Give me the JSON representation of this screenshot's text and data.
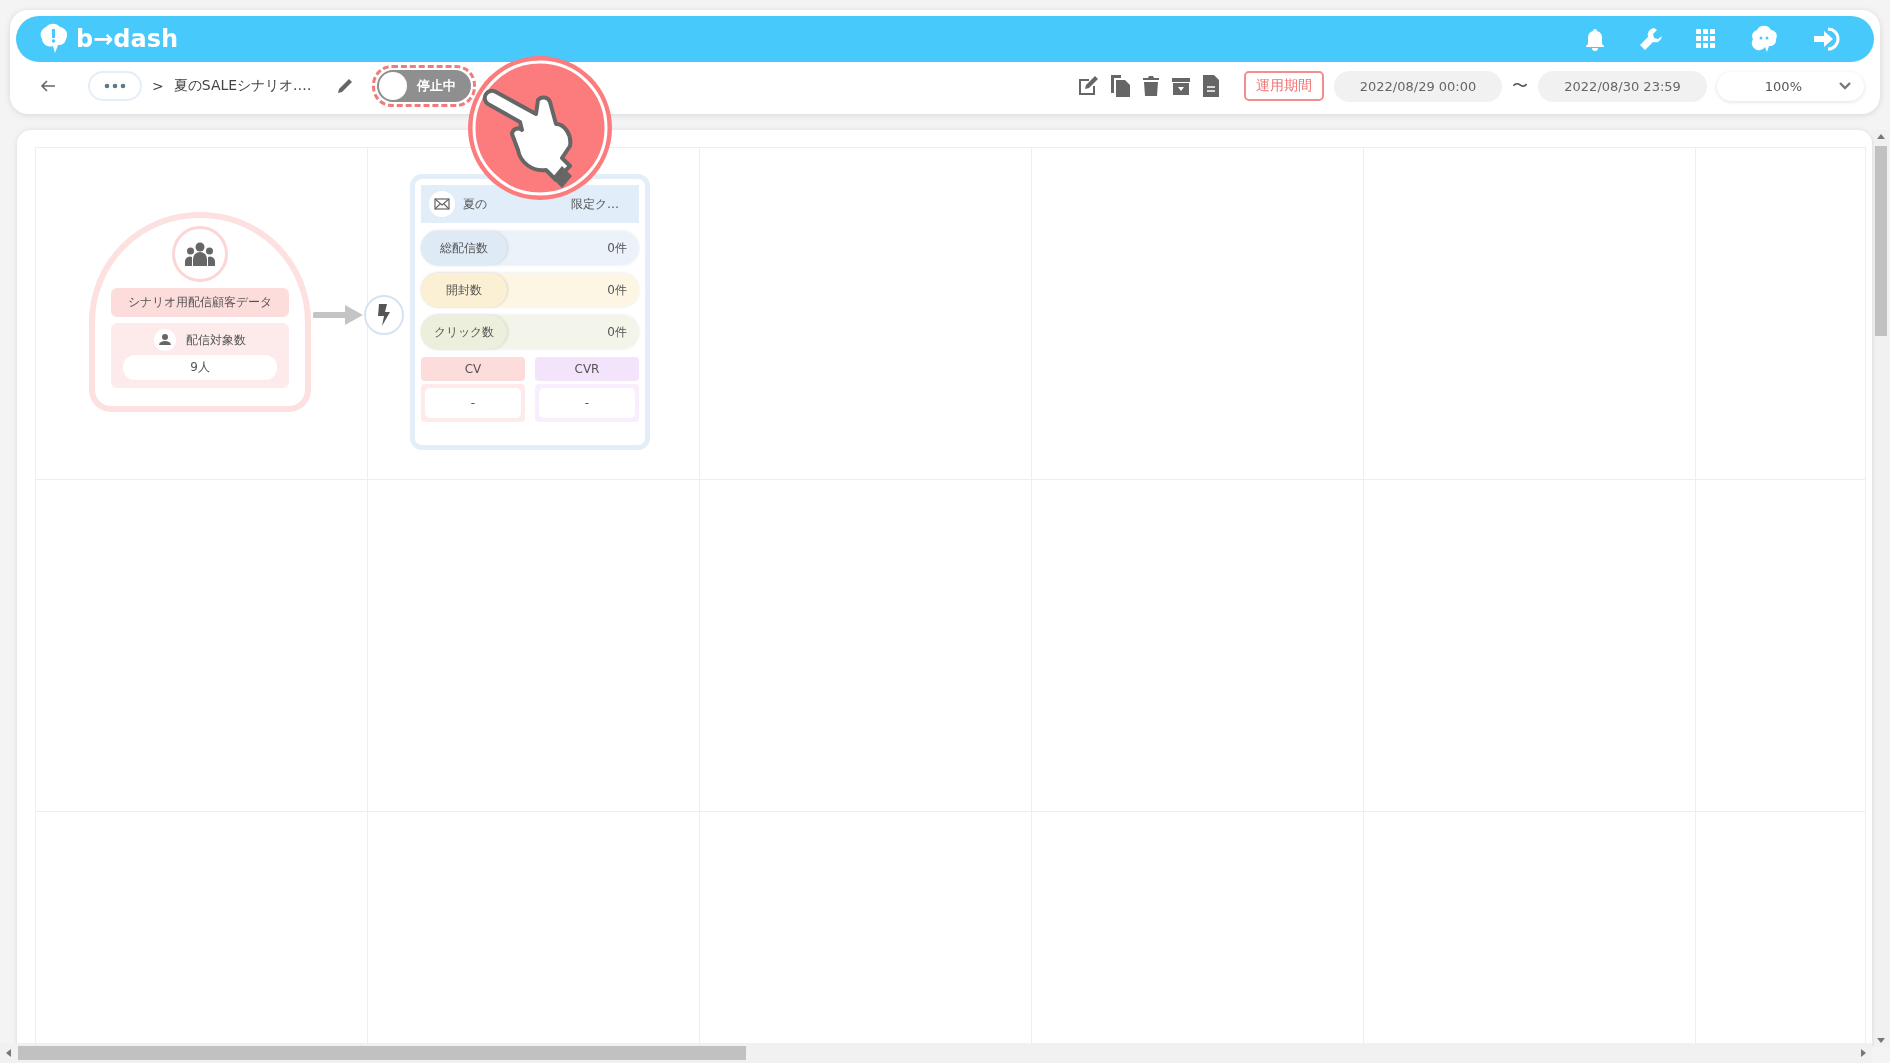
{
  "header": {
    "logo": "b→dash"
  },
  "toolbar": {
    "breadcrumb_separator": ">",
    "breadcrumb": "夏のSALEシナリオ.…",
    "toggle": {
      "label": "停止中",
      "on": false
    },
    "period_button": "運用期間",
    "start": "2022/08/29 00:00",
    "range_sep": "〜",
    "end": "2022/08/30 23:59",
    "zoom": "100%"
  },
  "audience_node": {
    "title": "シナリオ用配信顧客データ",
    "count_label": "配信対象数",
    "count": "9人"
  },
  "mail_node": {
    "title_start": "夏の",
    "title_end": "限定ク…",
    "metrics": [
      {
        "label": "総配信数",
        "value": "0件",
        "color": "#dfeaf7"
      },
      {
        "label": "開封数",
        "value": "0件",
        "color": "#fbf0d3"
      },
      {
        "label": "クリック数",
        "value": "0件",
        "color": "#ebefdc"
      }
    ],
    "results": [
      {
        "label": "CV",
        "value": "-",
        "color": "#fddcdc"
      },
      {
        "label": "CVR",
        "value": "-",
        "color": "#f3e3fb"
      }
    ]
  }
}
